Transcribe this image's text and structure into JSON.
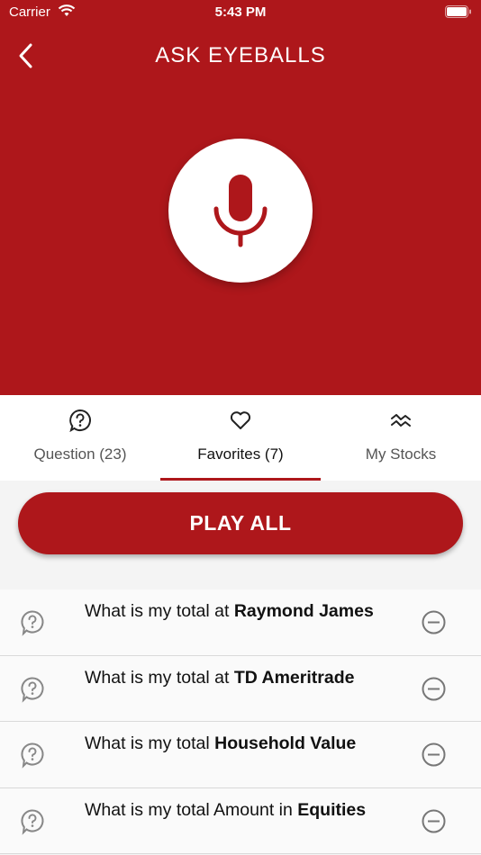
{
  "status_bar": {
    "carrier": "Carrier",
    "time": "5:43 PM"
  },
  "header": {
    "title": "ASK EYEBALLS"
  },
  "tabs": [
    {
      "label": "Question (23)",
      "icon": "question-bubble-icon",
      "active": false
    },
    {
      "label": "Favorites (7)",
      "icon": "heart-icon",
      "active": true
    },
    {
      "label": "My Stocks",
      "icon": "stocks-wave-icon",
      "active": false
    }
  ],
  "play_all_label": "PLAY ALL",
  "questions": [
    {
      "prefix": "What is my total at ",
      "highlight": "Raymond James"
    },
    {
      "prefix": "What is my total at ",
      "highlight": "TD Ameritrade"
    },
    {
      "prefix": "What is my total ",
      "highlight": "Household Value"
    },
    {
      "prefix": "What is my total Amount in ",
      "highlight": "Equities"
    }
  ],
  "colors": {
    "brand_red": "#ae171b"
  }
}
